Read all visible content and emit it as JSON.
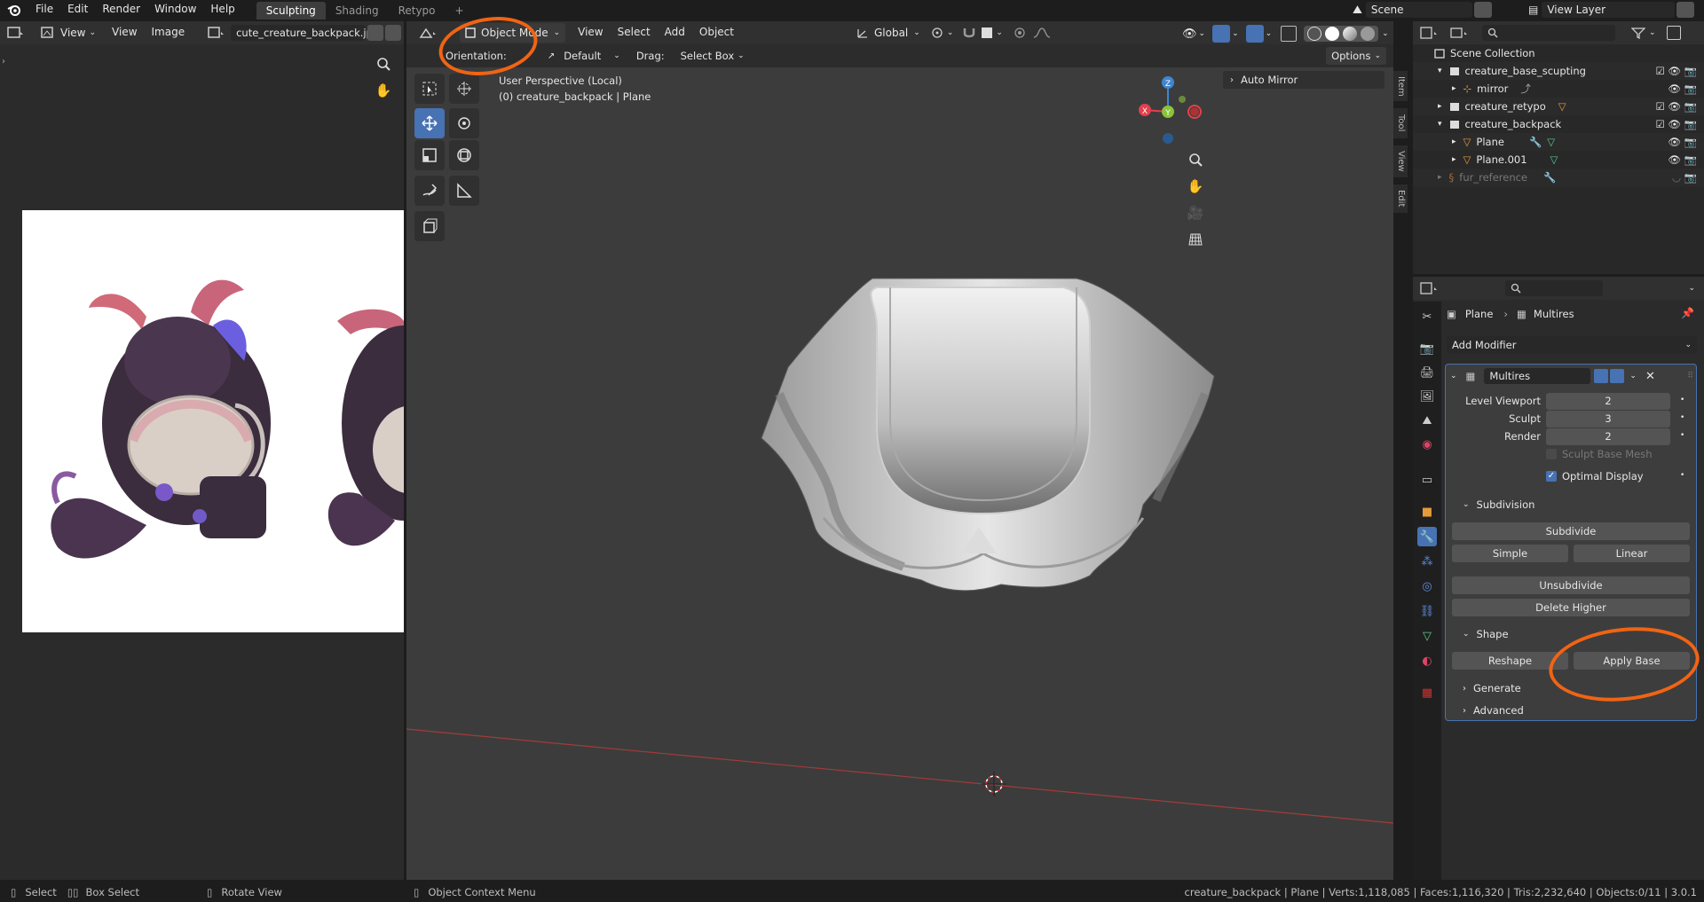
{
  "topbar": {
    "menus": [
      "File",
      "Edit",
      "Render",
      "Window",
      "Help"
    ],
    "workspaces": [
      "Sculpting",
      "Shading",
      "Retypo"
    ],
    "active_workspace": "Sculpting",
    "add_tab": "+",
    "scene_name": "Scene",
    "view_layer": "View Layer"
  },
  "image_editor": {
    "view_menu": "View",
    "menus": [
      "View",
      "Image"
    ],
    "image_name": "cute_creature_backpack.jpg"
  },
  "viewport": {
    "mode": "Object Mode",
    "menus": [
      "View",
      "Select",
      "Add",
      "Object"
    ],
    "transform_space": "Global",
    "orientation_label": "Orientation:",
    "orientation_value": "Default",
    "drag_label": "Drag:",
    "drag_value": "Select Box",
    "options": "Options",
    "info_line1": "User Perspective (Local)",
    "info_line2": "(0) creature_backpack | Plane",
    "auto_mirror": "Auto Mirror",
    "side_tabs": [
      "Item",
      "Tool",
      "View",
      "Edit"
    ],
    "gizmo_axes": [
      "Z",
      "Y",
      "X"
    ]
  },
  "outliner": {
    "search_placeholder": "",
    "root": "Scene Collection",
    "items": [
      {
        "label": "creature_base_scupting",
        "level": 1
      },
      {
        "label": "mirror",
        "level": 2
      },
      {
        "label": "creature_retypo",
        "level": 1
      },
      {
        "label": "creature_backpack",
        "level": 1
      },
      {
        "label": "Plane",
        "level": 2
      },
      {
        "label": "Plane.001",
        "level": 2
      },
      {
        "label": "fur_reference",
        "level": 1
      }
    ]
  },
  "properties": {
    "breadcrumb_object": "Plane",
    "breadcrumb_modifier": "Multires",
    "add_modifier": "Add Modifier",
    "modifier_name": "Multires",
    "fields": [
      {
        "label": "Level Viewport",
        "value": "2"
      },
      {
        "label": "Sculpt",
        "value": "3"
      },
      {
        "label": "Render",
        "value": "2"
      }
    ],
    "sculpt_base_mesh": "Sculpt Base Mesh",
    "optimal_display": "Optimal Display",
    "section_subdivision": "Subdivision",
    "subdivide": "Subdivide",
    "simple": "Simple",
    "linear": "Linear",
    "unsubdivide": "Unsubdivide",
    "delete_higher": "Delete Higher",
    "section_shape": "Shape",
    "reshape": "Reshape",
    "apply_base": "Apply Base",
    "section_generate": "Generate",
    "section_advanced": "Advanced"
  },
  "statusbar": {
    "select": "Select",
    "box_select": "Box Select",
    "rotate_view": "Rotate View",
    "context_menu": "Object Context Menu",
    "stats": "creature_backpack | Plane | Verts:1,118,085 | Faces:1,116,320 | Tris:2,232,640 | Objects:0/11 | 3.0.1"
  },
  "colors": {
    "accent_blue": "#4772b3",
    "annotation_orange": "#f06414",
    "axis_x": "#e2404f",
    "axis_y": "#8bc33a",
    "axis_z": "#3f86d1"
  }
}
